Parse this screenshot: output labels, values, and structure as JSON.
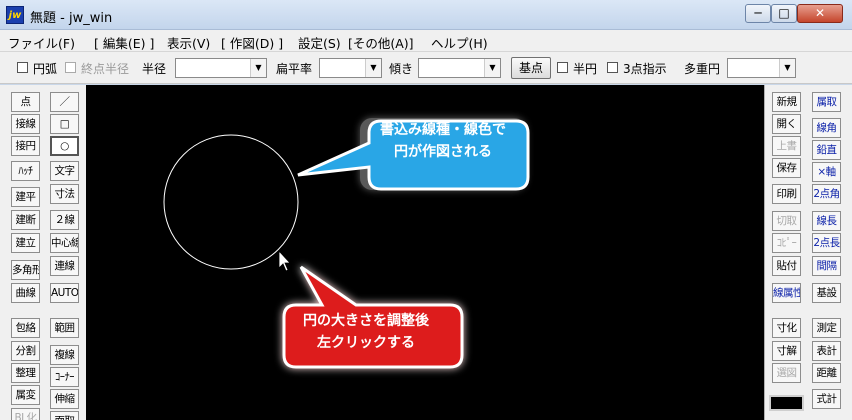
{
  "window": {
    "icon_label": "jw",
    "title": "無題 - jw_win",
    "minimize": "─",
    "maximize": "□",
    "close": "✕"
  },
  "menu": [
    "ファイル(F)",
    "[ 編集(E) ]",
    "表示(V)",
    "[ 作図(D) ]",
    "設定(S)",
    "[その他(A)]",
    "ヘルプ(H)"
  ],
  "toolbar": {
    "arc": "円弧",
    "endpoint_radius": "終点半径",
    "radius": "半径",
    "flatness": "扁平率",
    "tilt": "傾き",
    "base_point": "基点",
    "half_circle": "半円",
    "three_point": "3点指示",
    "multi_circle": "多重円"
  },
  "left_tools": {
    "col1": [
      "点",
      "接線",
      "接円",
      "ﾊｯﾁ",
      "建平",
      "建断",
      "建立",
      "多角形",
      "曲線",
      "包絡",
      "分割",
      "整理",
      "属変",
      "BL化"
    ],
    "col2": [
      "／",
      "□",
      "○",
      "文字",
      "寸法",
      "２線",
      "中心線",
      "連線",
      "AUTO",
      "範囲",
      "複線",
      "ｺｰﾅｰ",
      "伸縮",
      "面取"
    ]
  },
  "right_tools": {
    "col1": [
      "新規",
      "開く",
      "上書",
      "保存",
      "印刷",
      "切取",
      "ｺﾋﾟｰ",
      "貼付",
      "線属性",
      "寸化",
      "寸解",
      "選図",
      ""
    ],
    "col2": [
      "属取",
      "線角",
      "鉛直",
      "×軸",
      "2点角",
      "線長",
      "2点長",
      "間隔",
      "基設",
      "測定",
      "表計",
      "距離",
      "式計"
    ]
  },
  "callouts": {
    "blue_line1": "書込み線種・線色で",
    "blue_line2": "円が作図される",
    "red_line1": "円の大きさを調整後",
    "red_line2": "左クリックする"
  },
  "colors": {
    "callout_blue": "#29a6e6",
    "callout_red": "#dd1d1d",
    "canvas": "#000000"
  }
}
